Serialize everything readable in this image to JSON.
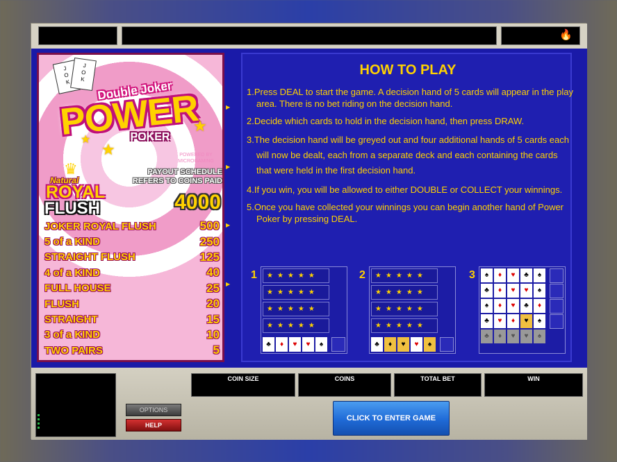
{
  "game": {
    "logo": {
      "double_joker": "Double Joker",
      "power": "POWER",
      "poker": "POKER",
      "card_text": "JOKER",
      "powered_by": "POWERED BY MICROGAMING"
    },
    "paytable": {
      "natural_label": "Natural",
      "royal_label": "ROYAL",
      "flush_label": "FLUSH",
      "note": "PAYOUT SCHEDULE REFERS TO COINS PAID",
      "top_value": "4000",
      "rows": [
        {
          "name": "JOKER ROYAL FLUSH",
          "value": "500"
        },
        {
          "name": "5 of a KIND",
          "value": "250"
        },
        {
          "name": "STRAIGHT FLUSH",
          "value": "125"
        },
        {
          "name": "4 of a KIND",
          "value": "40"
        },
        {
          "name": "FULL HOUSE",
          "value": "25"
        },
        {
          "name": "FLUSH",
          "value": "20"
        },
        {
          "name": "STRAIGHT",
          "value": "15"
        },
        {
          "name": "3 of a KIND",
          "value": "10"
        },
        {
          "name": "TWO PAIRS",
          "value": "5"
        }
      ]
    },
    "howto": {
      "title": "HOW TO PLAY",
      "steps": [
        "1.Press DEAL to start the game.  A decision hand of 5 cards will appear in the play area. There is no bet riding on the decision hand.",
        "2.Decide which cards to hold in the decision hand, then press DRAW.",
        "3.The decision hand will be greyed out and four additional hands of 5 cards each will now be dealt, each from a separate deck and each containing the cards that were held in the first decision hand.",
        "4.If you win, you will be allowed to either DOUBLE or COLLECT your winnings.",
        "5.Once you have collected your winnings you can begin another hand of Power Poker by pressing DEAL."
      ],
      "diagram_numbers": [
        "1",
        "2",
        "3"
      ]
    },
    "controls": {
      "options_label": "OPTIONS",
      "help_label": "HELP",
      "enter_label": "CLICK TO ENTER GAME",
      "meters": [
        {
          "label": "COIN SIZE",
          "value": ""
        },
        {
          "label": "COINS",
          "value": ""
        },
        {
          "label": "TOTAL BET",
          "value": ""
        },
        {
          "label": "WIN",
          "value": ""
        }
      ]
    },
    "colors": {
      "background_blue": "#1a1aa8",
      "text_yellow": "#ffd200",
      "paytable_pink": "#f6b7d8",
      "enter_button_blue": "#1f6ad6",
      "help_red": "#d43030"
    },
    "icons": {
      "flame": "flame-icon"
    }
  }
}
